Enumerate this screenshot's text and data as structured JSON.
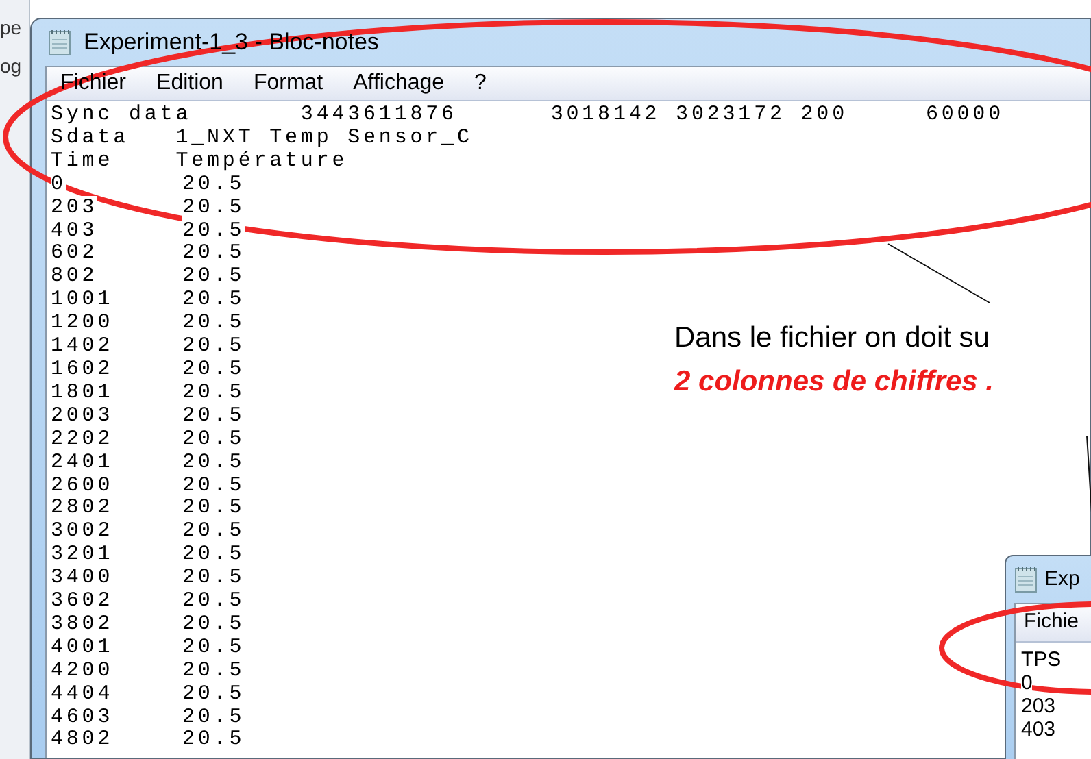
{
  "background_window": {
    "fragments": [
      "pe",
      "og"
    ]
  },
  "notepad": {
    "title": "Experiment-1_3 - Bloc-notes",
    "menu": [
      "Fichier",
      "Edition",
      "Format",
      "Affichage",
      "?"
    ],
    "header_lines": [
      "Sync data       3443611876      3018142 3023172 200     60000",
      "Sdata   1_NXT Temp Sensor_C",
      "Time    Température"
    ],
    "rows": [
      {
        "time": "0",
        "value": "20.5"
      },
      {
        "time": "203",
        "value": "20.5"
      },
      {
        "time": "403",
        "value": "20.5"
      },
      {
        "time": "602",
        "value": "20.5"
      },
      {
        "time": "802",
        "value": "20.5"
      },
      {
        "time": "1001",
        "value": "20.5"
      },
      {
        "time": "1200",
        "value": "20.5"
      },
      {
        "time": "1402",
        "value": "20.5"
      },
      {
        "time": "1602",
        "value": "20.5"
      },
      {
        "time": "1801",
        "value": "20.5"
      },
      {
        "time": "2003",
        "value": "20.5"
      },
      {
        "time": "2202",
        "value": "20.5"
      },
      {
        "time": "2401",
        "value": "20.5"
      },
      {
        "time": "2600",
        "value": "20.5"
      },
      {
        "time": "2802",
        "value": "20.5"
      },
      {
        "time": "3002",
        "value": "20.5"
      },
      {
        "time": "3201",
        "value": "20.5"
      },
      {
        "time": "3400",
        "value": "20.5"
      },
      {
        "time": "3602",
        "value": "20.5"
      },
      {
        "time": "3802",
        "value": "20.5"
      },
      {
        "time": "4001",
        "value": "20.5"
      },
      {
        "time": "4200",
        "value": "20.5"
      },
      {
        "time": "4404",
        "value": "20.5"
      },
      {
        "time": "4603",
        "value": "20.5"
      },
      {
        "time": "4802",
        "value": "20.5"
      }
    ]
  },
  "callout": {
    "line_1": "Dans le fichier on doit su",
    "line_2": "2 colonnes de chiffres ."
  },
  "second_notepad": {
    "title": "Exp",
    "menu": [
      "Fichie"
    ],
    "lines": [
      "TPS",
      "0",
      "203",
      "403"
    ]
  }
}
